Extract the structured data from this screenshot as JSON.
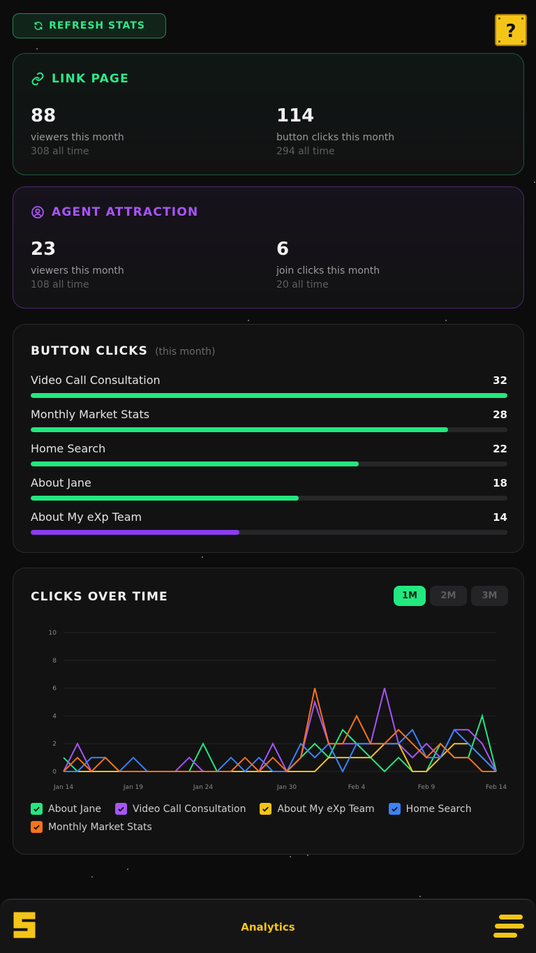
{
  "toolbar": {
    "refresh_label": "REFRESH STATS",
    "refresh_icon": "refresh-icon",
    "help_icon": "question-block-icon"
  },
  "link_page": {
    "title": "LINK PAGE",
    "icon": "link-icon",
    "stats": [
      {
        "value": "88",
        "label": "viewers this month",
        "sub": "308 all time"
      },
      {
        "value": "114",
        "label": "button clicks this month",
        "sub": "294 all time"
      }
    ]
  },
  "agent_attraction": {
    "title": "AGENT ATTRACTION",
    "icon": "user-circle-icon",
    "stats": [
      {
        "value": "23",
        "label": "viewers this month",
        "sub": "108 all time"
      },
      {
        "value": "6",
        "label": "join clicks this month",
        "sub": "20 all time"
      }
    ]
  },
  "button_clicks": {
    "title": "BUTTON CLICKS",
    "subtitle": "(this month)",
    "items": [
      {
        "name": "Video Call Consultation",
        "value": "32",
        "fraction": 1.0,
        "color": "#22e87f"
      },
      {
        "name": "Monthly Market Stats",
        "value": "28",
        "fraction": 0.875,
        "color": "#22e87f"
      },
      {
        "name": "Home Search",
        "value": "22",
        "fraction": 0.6875,
        "color": "#22e87f"
      },
      {
        "name": "About Jane",
        "value": "18",
        "fraction": 0.5625,
        "color": "#22e87f"
      },
      {
        "name": "About My eXp Team",
        "value": "14",
        "fraction": 0.4375,
        "color": "#8b3cf0"
      }
    ]
  },
  "clicks_over_time": {
    "title": "CLICKS OVER TIME",
    "ranges": [
      {
        "label": "1M",
        "active": true
      },
      {
        "label": "2M",
        "active": false
      },
      {
        "label": "3M",
        "active": false
      }
    ]
  },
  "chart_data": {
    "type": "line",
    "x": [
      "Jan 14",
      "Jan 15",
      "Jan 16",
      "Jan 17",
      "Jan 18",
      "Jan 19",
      "Jan 20",
      "Jan 21",
      "Jan 22",
      "Jan 23",
      "Jan 24",
      "Jan 25",
      "Jan 26",
      "Jan 27",
      "Jan 28",
      "Jan 29",
      "Jan 30",
      "Jan 31",
      "Feb 1",
      "Feb 2",
      "Feb 3",
      "Feb 4",
      "Feb 5",
      "Feb 6",
      "Feb 7",
      "Feb 8",
      "Feb 9",
      "Feb 10",
      "Feb 11",
      "Feb 12",
      "Feb 13",
      "Feb 14"
    ],
    "x_ticks": [
      "Jan 14",
      "Jan 19",
      "Jan 24",
      "Jan 30",
      "Feb 4",
      "Feb 9",
      "Feb 14"
    ],
    "ylim": [
      0,
      10
    ],
    "y_ticks": [
      0,
      2,
      4,
      6,
      8,
      10
    ],
    "grid": true,
    "legend_position": "bottom",
    "series": [
      {
        "name": "About Jane",
        "color": "#22e87f",
        "values": [
          1,
          0,
          0,
          0,
          0,
          0,
          0,
          0,
          0,
          0,
          2,
          0,
          0,
          0,
          0,
          0,
          0,
          1,
          2,
          1,
          3,
          2,
          1,
          0,
          1,
          0,
          0,
          2,
          1,
          1,
          4,
          0
        ]
      },
      {
        "name": "Video Call Consultation",
        "color": "#a855f7",
        "values": [
          0,
          2,
          0,
          0,
          0,
          0,
          0,
          0,
          0,
          1,
          0,
          0,
          0,
          0,
          0,
          2,
          0,
          1,
          5,
          2,
          2,
          2,
          2,
          6,
          2,
          1,
          2,
          1,
          3,
          3,
          2,
          0
        ]
      },
      {
        "name": "About My eXp Team",
        "color": "#f4c517",
        "values": [
          0,
          0,
          0,
          0,
          0,
          0,
          0,
          0,
          0,
          0,
          0,
          0,
          0,
          0,
          0,
          0,
          0,
          0,
          0,
          1,
          1,
          1,
          1,
          2,
          2,
          0,
          0,
          1,
          2,
          2,
          1,
          0
        ]
      },
      {
        "name": "Home Search",
        "color": "#3b82f6",
        "values": [
          0,
          0,
          1,
          1,
          0,
          1,
          0,
          0,
          0,
          0,
          0,
          0,
          1,
          0,
          1,
          0,
          0,
          2,
          1,
          2,
          0,
          2,
          2,
          2,
          2,
          3,
          1,
          1,
          3,
          2,
          1,
          0
        ]
      },
      {
        "name": "Monthly Market Stats",
        "color": "#f97316",
        "values": [
          0,
          1,
          0,
          1,
          0,
          0,
          0,
          0,
          0,
          0,
          0,
          0,
          0,
          1,
          0,
          1,
          0,
          1,
          6,
          2,
          2,
          4,
          2,
          2,
          3,
          2,
          1,
          2,
          1,
          1,
          0,
          0
        ]
      }
    ]
  },
  "nav": {
    "title": "Analytics",
    "logo_icon": "brand-s-logo-icon",
    "menu_icon": "hamburger-menu-icon"
  }
}
